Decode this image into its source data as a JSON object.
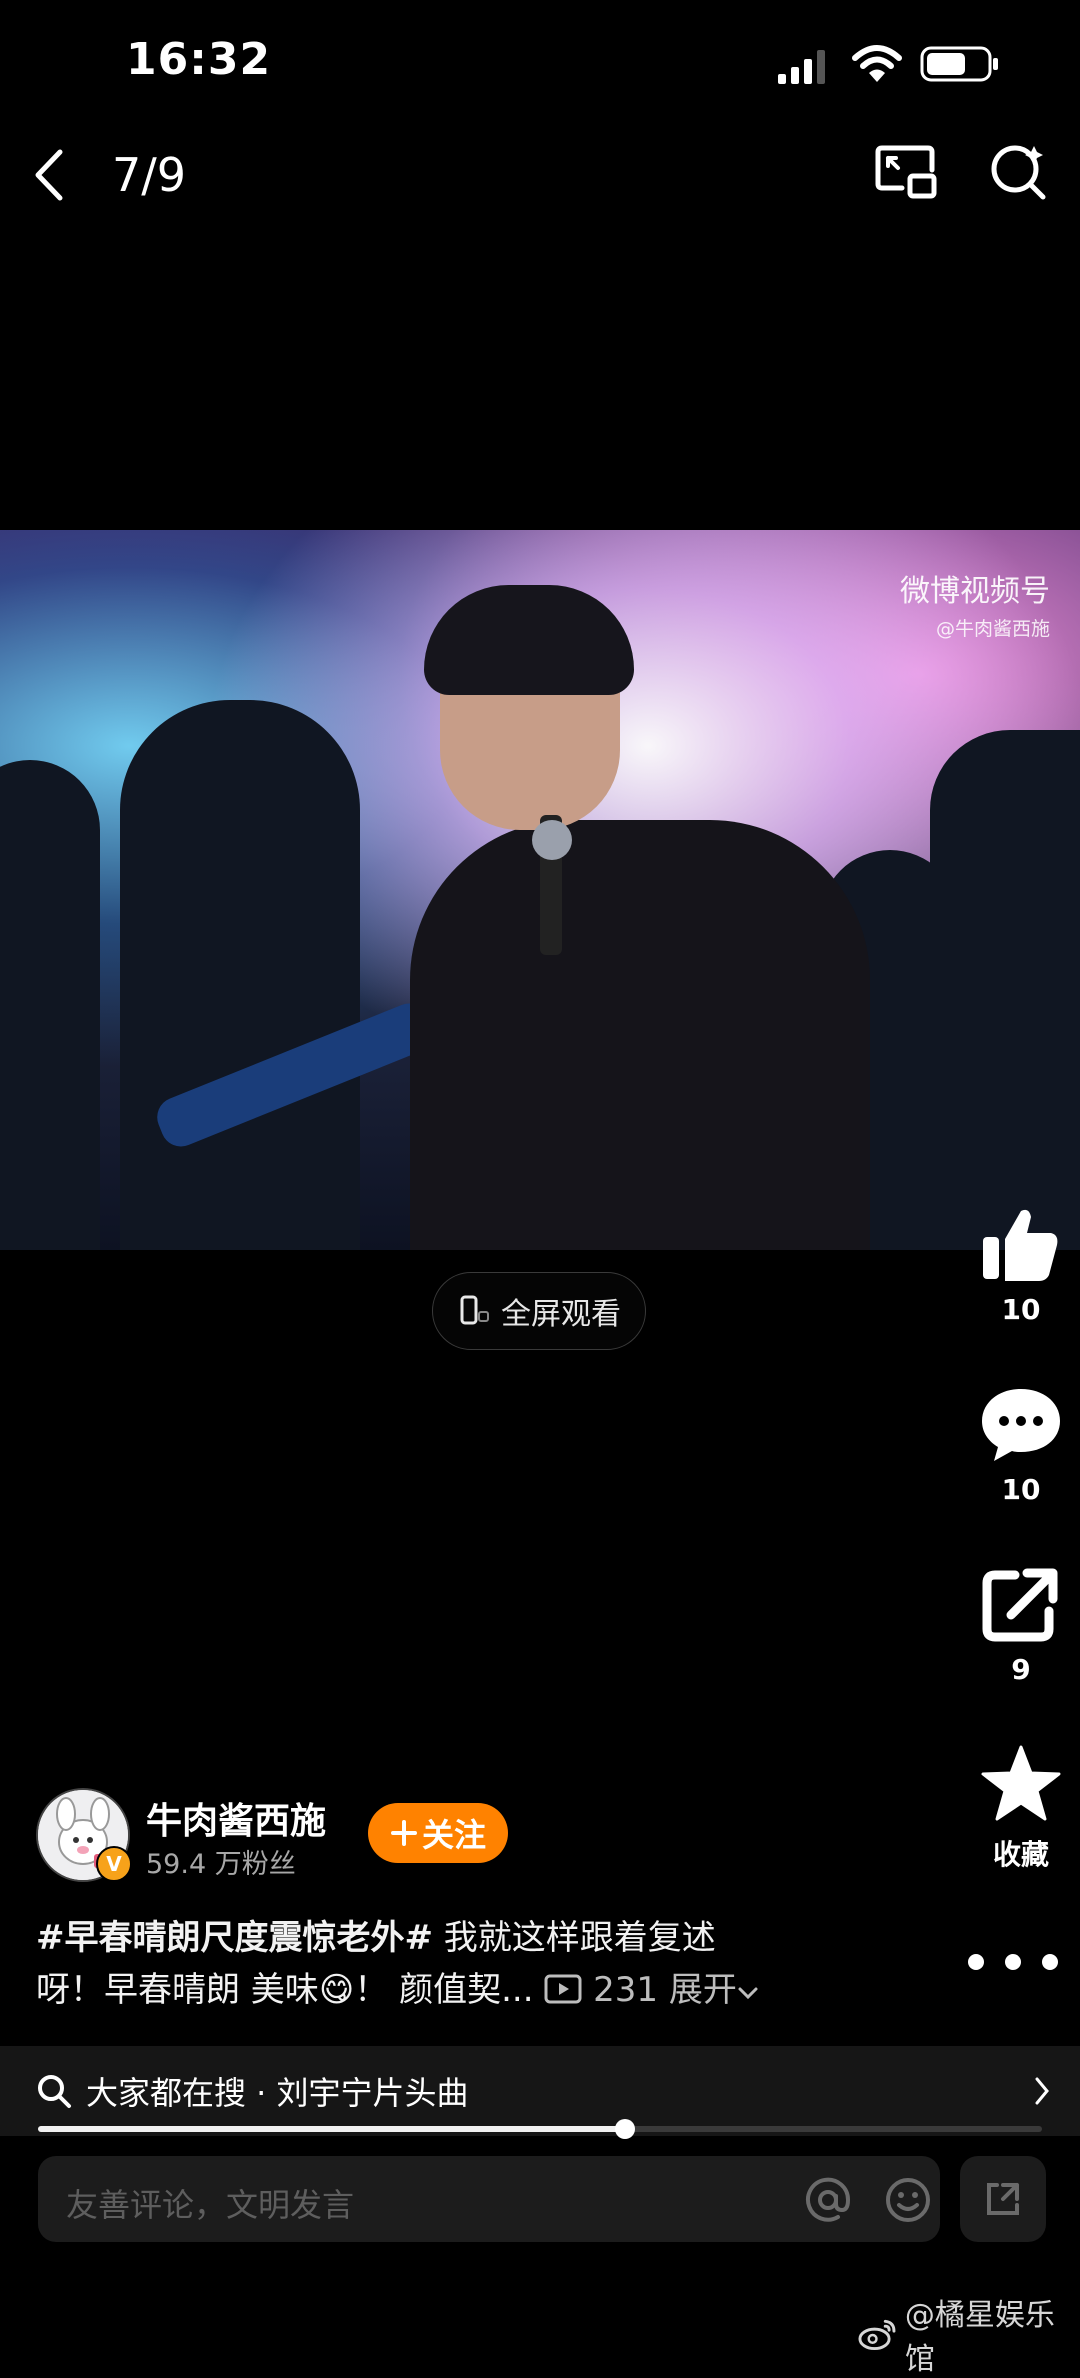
{
  "status_bar": {
    "time": "16:32"
  },
  "nav": {
    "page_counter": "7/9"
  },
  "video": {
    "watermark_title": "微博视频号",
    "watermark_handle": "@牛肉酱西施"
  },
  "fullscreen": {
    "label": "全屏观看"
  },
  "actions": {
    "like_count": "10",
    "comment_count": "10",
    "share_count": "9",
    "favorite_label": "收藏"
  },
  "author": {
    "name": "牛肉酱西施",
    "fans": "59.4 万粉丝",
    "follow_label": "关注",
    "verified_badge": "V"
  },
  "caption": {
    "hashtag": "#早春晴朗尺度震惊老外#",
    "line1_text": " 我就这样跟着复述",
    "line2_text": "呀！早春晴朗 美味",
    "emoji": "😋",
    "line2_rest": "！ 颜值契...",
    "play_count": "231",
    "expand_label": "展开"
  },
  "search_suggestion": {
    "text": "大家都在搜 · 刘宇宁片头曲"
  },
  "progress": {
    "fraction": 0.585
  },
  "comment_box": {
    "placeholder": "友善评论，文明发言"
  },
  "source_watermark": {
    "text": "@橘星娱乐馆"
  },
  "colors": {
    "accent_orange": "#ff8200",
    "background": "#000000"
  }
}
